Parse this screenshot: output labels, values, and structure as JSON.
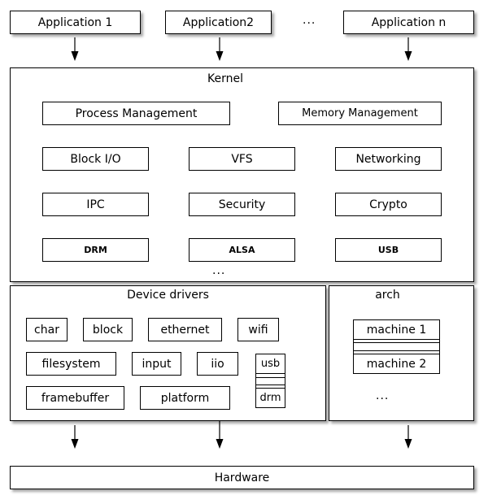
{
  "applications": [
    {
      "label": "Application 1"
    },
    {
      "label": "Application2"
    },
    {
      "label": "Application n"
    }
  ],
  "applications_ellipsis": "...",
  "kernel": {
    "title": "Kernel",
    "components": [
      "Process Management",
      "Memory Management",
      "Block I/O",
      "VFS",
      "Networking",
      "IPC",
      "Security",
      "Crypto",
      "DRM",
      "ALSA",
      "USB"
    ],
    "ellipsis": "..."
  },
  "device_drivers": {
    "title": "Device drivers",
    "items": [
      "char",
      "block",
      "ethernet",
      "wifi",
      "filesystem",
      "input",
      "iio",
      "framebuffer",
      "platform"
    ],
    "stack": [
      "usb",
      "drm"
    ]
  },
  "arch": {
    "title": "arch",
    "stack": [
      "machine 1",
      "machine 2"
    ],
    "ellipsis": "..."
  },
  "hardware": {
    "title": "Hardware"
  }
}
